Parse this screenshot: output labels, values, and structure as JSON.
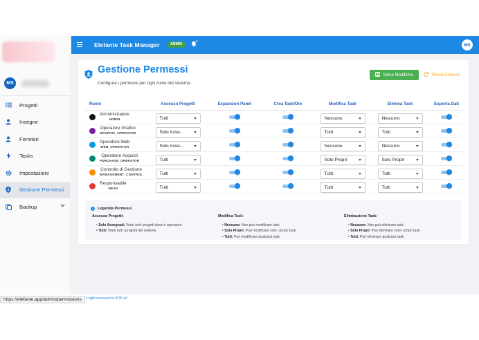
{
  "app": {
    "title": "Elefante Task Manager",
    "badge": "ADMIN",
    "notifications": "0",
    "user_initials": "MS"
  },
  "sidebar": {
    "user_initials": "MS",
    "items": [
      {
        "label": "Progetti",
        "icon": "list-icon"
      },
      {
        "label": "Insegne",
        "icon": "person-icon"
      },
      {
        "label": "Fornitori",
        "icon": "person-icon"
      },
      {
        "label": "Tasks",
        "icon": "bolt-icon"
      },
      {
        "label": "Impostazioni",
        "icon": "gear-icon"
      },
      {
        "label": "Gestione Permessi",
        "icon": "shield-icon",
        "active": true
      },
      {
        "label": "Backup",
        "icon": "backup-icon",
        "expandable": true
      }
    ]
  },
  "header": {
    "title": "Gestione Permessi",
    "subtitle": "Configura i permessi per ogni ruolo del sistema",
    "save_label": "Salva Modifiche",
    "reset_label": "Reset Defaults"
  },
  "table": {
    "columns": [
      "Ruolo",
      "Accesso Progetti",
      "Expansion Panel",
      "Crea Task/Ore",
      "Modifica Task",
      "Elimina Task",
      "Esporta Dati"
    ],
    "rows": [
      {
        "name": "Amministratore",
        "code": "ADMIN",
        "icon_color": "#111111",
        "accesso": "Tutti",
        "expansion": true,
        "crea": true,
        "modifica": "Nessuno",
        "elimina": "Nessuno",
        "esporta": true
      },
      {
        "name": "Operatore Grafico",
        "code": "GRAPHIC_OPERATOR",
        "icon_color": "#7b1fa2",
        "accesso": "Solo Asse...",
        "expansion": true,
        "crea": true,
        "modifica": "Tutti",
        "elimina": "Tutti",
        "esporta": true
      },
      {
        "name": "Operatore Web",
        "code": "WEB_OPERATOR",
        "icon_color": "#039be5",
        "accesso": "Solo Asse...",
        "expansion": true,
        "crea": true,
        "modifica": "Nessuno",
        "elimina": "Nessuno",
        "esporta": true
      },
      {
        "name": "Operatore Acquisti",
        "code": "PURCHASE_OPERATOR",
        "icon_color": "#00897b",
        "accesso": "Tutti",
        "expansion": true,
        "crea": true,
        "modifica": "Solo Propri",
        "elimina": "Solo Propri",
        "esporta": true
      },
      {
        "name": "Controllo di Gestione",
        "code": "MANAGEMENT_CONTROL",
        "icon_color": "#fb8c00",
        "accesso": "Tutti",
        "expansion": true,
        "crea": true,
        "modifica": "Tutti",
        "elimina": "Tutti",
        "esporta": true
      },
      {
        "name": "Responsabile",
        "code": "HEAD",
        "icon_color": "#e53935",
        "accesso": "Tutti",
        "expansion": true,
        "crea": true,
        "modifica": "Tutti",
        "elimina": "Tutti",
        "esporta": true
      }
    ]
  },
  "legend": {
    "title": "Legenda Permessi",
    "sections": [
      {
        "heading": "Accesso Progetti:",
        "lines": [
          {
            "key": "Solo Assegnati:",
            "text": " Vede solo progetti dove è operatore"
          },
          {
            "key": "Tutti:",
            "text": " Vede tutti i progetti del sistema"
          }
        ]
      },
      {
        "heading": "Modifica Task:",
        "lines": [
          {
            "key": "Nessuno:",
            "text": " Non può modificare task"
          },
          {
            "key": "Solo Propri:",
            "text": " Può modificare solo i propri task"
          },
          {
            "key": "Tutti:",
            "text": " Può modificare qualsiasi task"
          }
        ]
      },
      {
        "heading": "Eliminazione Task:",
        "lines": [
          {
            "key": "Nessuno:",
            "text": " Non può eliminare task"
          },
          {
            "key": "Solo Propri:",
            "text": " Può eliminare solo i propri task"
          },
          {
            "key": "Tutti:",
            "text": " Può eliminare qualsiasi task"
          }
        ]
      }
    ]
  },
  "status": {
    "url": "https://elefante.app/admin/permissions",
    "copyright": "ll right reserved to IF65 srl"
  }
}
